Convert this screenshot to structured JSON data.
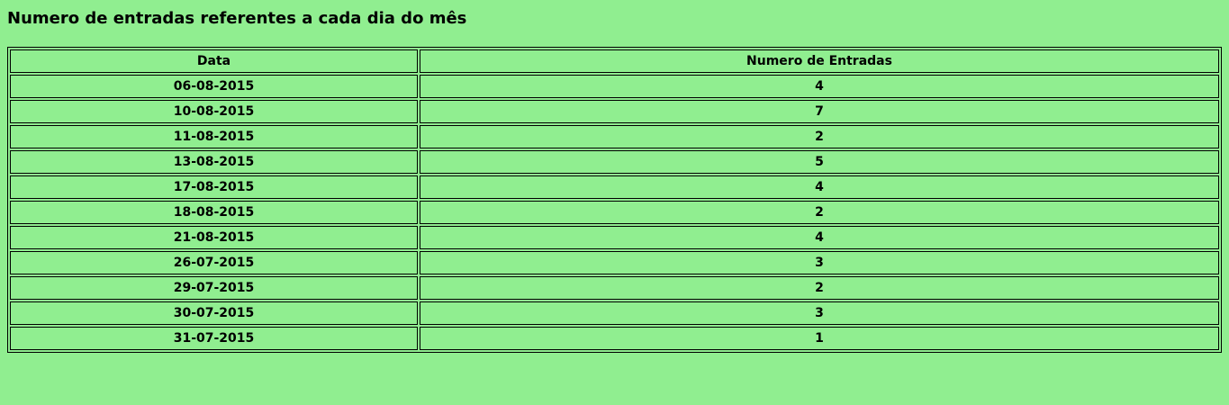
{
  "heading": "Numero de entradas referentes a cada dia do mês",
  "table": {
    "headers": [
      "Data",
      "Numero de Entradas"
    ],
    "rows": [
      {
        "date": "06-08-2015",
        "count": "4"
      },
      {
        "date": "10-08-2015",
        "count": "7"
      },
      {
        "date": "11-08-2015",
        "count": "2"
      },
      {
        "date": "13-08-2015",
        "count": "5"
      },
      {
        "date": "17-08-2015",
        "count": "4"
      },
      {
        "date": "18-08-2015",
        "count": "2"
      },
      {
        "date": "21-08-2015",
        "count": "4"
      },
      {
        "date": "26-07-2015",
        "count": "3"
      },
      {
        "date": "29-07-2015",
        "count": "2"
      },
      {
        "date": "30-07-2015",
        "count": "3"
      },
      {
        "date": "31-07-2015",
        "count": "1"
      }
    ]
  }
}
